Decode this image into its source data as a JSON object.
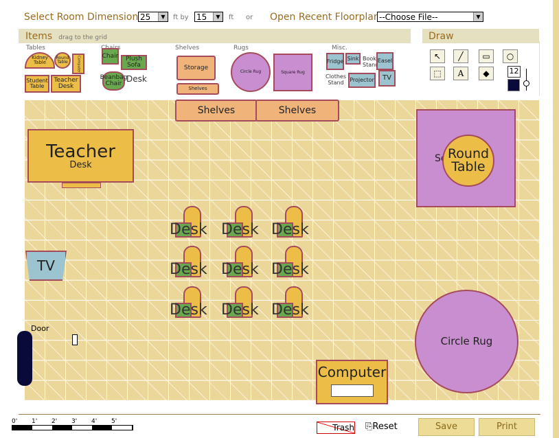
{
  "top": {
    "dims_label": "Select Room Dimensions",
    "width": "25",
    "ft_by": "ft by",
    "length": "15",
    "ft": "ft",
    "or": "or",
    "recent_label": "Open Recent Floorplan",
    "recent_value": "--Choose File--"
  },
  "items_panel": {
    "title": "Items",
    "hint": "drag to the grid",
    "categories": {
      "tables": "Tables",
      "chairs": "Chairs",
      "shelves": "Shelves",
      "rugs": "Rugs",
      "misc": "Misc."
    },
    "tables": [
      "Kidney Table",
      "Round Table",
      "Computer",
      "Student Table",
      "Teacher Desk"
    ],
    "chairs": [
      "Chair",
      "Plush Sofa",
      "Beanbag Chair",
      "Desk"
    ],
    "shelves": [
      "Storage",
      "Shelves"
    ],
    "rugs": [
      "Circle Rug",
      "Square Rug"
    ],
    "misc": [
      "Fridge",
      "Sink",
      "Book Stand",
      "Easel",
      "Clothes Stand",
      "Projector",
      "TV"
    ]
  },
  "draw_panel": {
    "title": "Draw",
    "font_size": "12",
    "stroke_color": "#0a0a3a",
    "tools": [
      "pointer-icon",
      "brush-icon",
      "rectangle-icon",
      "circle-icon",
      "select-box-icon",
      "text-icon",
      "fill-icon"
    ],
    "text_glyph": "A"
  },
  "grid": {
    "teacher_desk": {
      "title": "Teacher",
      "sub": "Desk"
    },
    "shelves": [
      "Shelves",
      "Shelves"
    ],
    "square_rug_label": "Square Rug",
    "round_table": "Round Table",
    "tv": "TV",
    "desks": [
      "Desk",
      "Desk",
      "Desk",
      "Desk",
      "Desk",
      "Desk",
      "Desk",
      "Desk",
      "Desk"
    ],
    "door": "Door",
    "circle_rug": "Circle Rug",
    "computer": "Computer"
  },
  "footer": {
    "scale": [
      "0'",
      "1'",
      "2'",
      "3'",
      "4'",
      "5'"
    ],
    "trash": "Trash",
    "reset": "Reset",
    "save": "Save",
    "print": "Print"
  }
}
